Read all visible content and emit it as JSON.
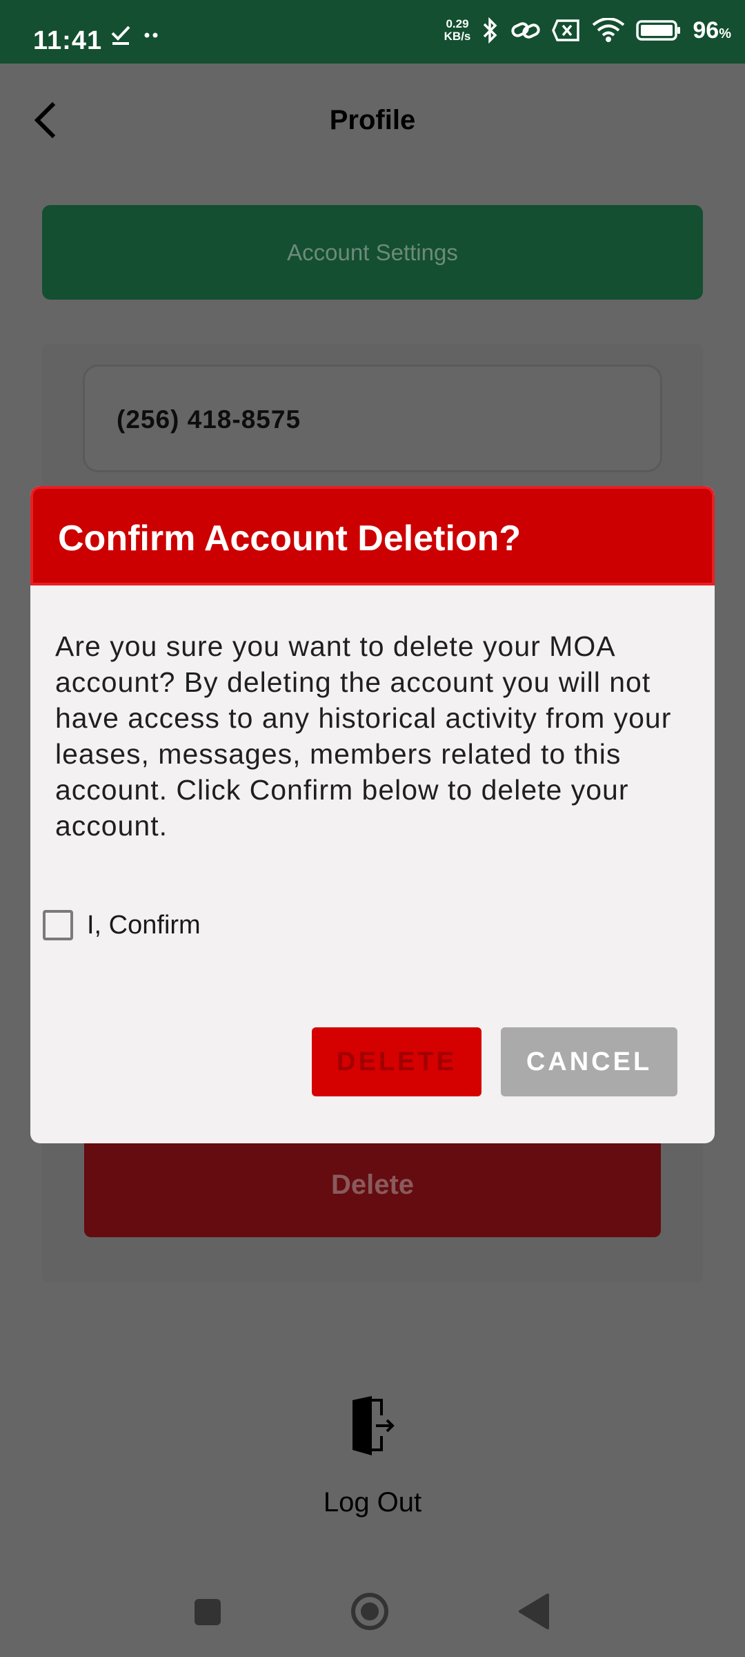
{
  "status_bar": {
    "time": "11:41",
    "net_speed_value": "0.29",
    "net_speed_unit": "KB/s",
    "battery_percent": "96",
    "battery_unit": "%",
    "left_icons": [
      "check-icon",
      "dots-icon"
    ],
    "right_icons": [
      "bluetooth-icon",
      "link-icon",
      "sim-off-icon",
      "wifi-icon",
      "battery-icon"
    ]
  },
  "header": {
    "title": "Profile",
    "back_icon": "chevron-left-icon"
  },
  "settings_bar": {
    "label": "Account Settings"
  },
  "phone_field": {
    "value": "(256) 418-8575"
  },
  "background_delete_button": {
    "label": "Delete"
  },
  "logout": {
    "label": "Log Out",
    "icon": "logout-door-icon"
  },
  "dialog": {
    "title": "Confirm Account Deletion?",
    "message": "Are you sure you want to delete your MOA account? By deleting the account you will not have access to any historical activity from your leases, messages, members related to this account. Click Confirm below to delete your account.",
    "checkbox_label": "I, Confirm",
    "checkbox_checked": false,
    "delete_label": "DELETE",
    "cancel_label": "CANCEL"
  },
  "nav_bar": {
    "icons": [
      "recents-icon",
      "home-icon",
      "back-icon"
    ]
  },
  "colors": {
    "status_bar": "#134f30",
    "accent_green": "#134f30",
    "danger_red": "#cc0000",
    "overlay_gray": "#666666"
  }
}
